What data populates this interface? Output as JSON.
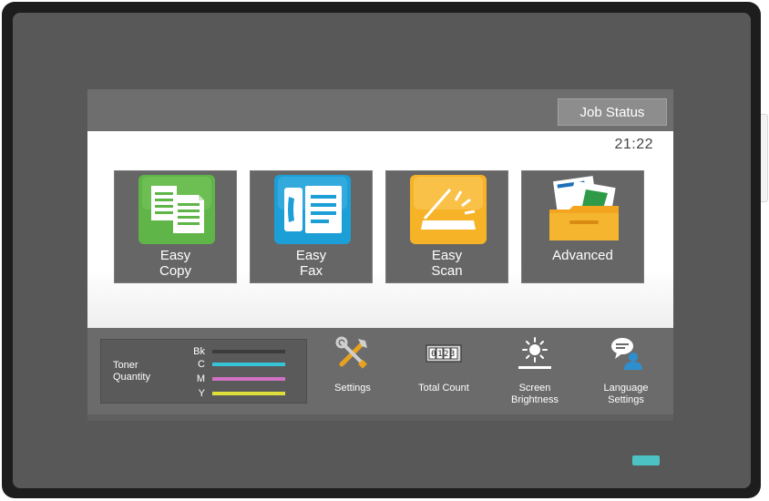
{
  "header": {
    "job_status_label": "Job Status"
  },
  "clock": {
    "time": "21:22"
  },
  "tiles": [
    {
      "line1": "Easy",
      "line2": "Copy",
      "icon": "copy-icon",
      "color": "#5fb548"
    },
    {
      "line1": "Easy",
      "line2": "Fax",
      "icon": "fax-icon",
      "color": "#1c9fd7"
    },
    {
      "line1": "Easy",
      "line2": "Scan",
      "icon": "scan-icon",
      "color": "#f6b327"
    },
    {
      "label": "Advanced",
      "icon": "folder-icon",
      "color": "#f5b52f"
    }
  ],
  "toner": {
    "title_line1": "Toner",
    "title_line2": "Quantity",
    "colors": [
      {
        "label": "Bk",
        "color": "#3c3c3c"
      },
      {
        "label": "C",
        "color": "#35c4d8"
      },
      {
        "label": "M",
        "color": "#d071c3"
      },
      {
        "label": "Y",
        "color": "#dedf3a"
      }
    ]
  },
  "functions": [
    {
      "line1": "Settings",
      "icon": "wrench-screwdriver-icon"
    },
    {
      "line1": "Total Count",
      "icon": "counter-icon",
      "digits": "0123"
    },
    {
      "line1": "Screen",
      "line2": "Brightness",
      "icon": "sun-icon"
    },
    {
      "line1": "Language",
      "line2": "Settings",
      "icon": "speech-person-icon"
    }
  ]
}
